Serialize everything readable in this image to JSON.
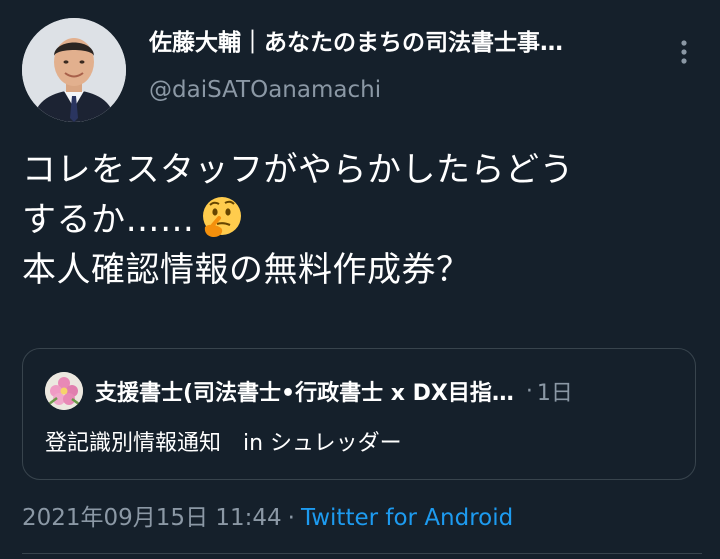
{
  "author": {
    "display_name": "佐藤大輔｜あなたのまちの司法書士事…",
    "handle": "@daiSATOanamachi"
  },
  "icons": {
    "more": "more-options-icon",
    "emoji": "thinking-face-emoji"
  },
  "tweet": {
    "line1": "コレをスタッフがやらかしたらどう",
    "line2": "するか……",
    "line3": "本人確認情報の無料作成券？"
  },
  "quote": {
    "name": "支援書士(司法書士•行政書士 x DX目指…",
    "separator": "·",
    "time": "1日",
    "body": "登記識別情報通知　in シュレッダー"
  },
  "meta": {
    "timestamp": "2021年09月15日 11:44",
    "separator": "·",
    "source": "Twitter for Android"
  },
  "colors": {
    "background": "#15202b",
    "secondary_text": "#8b98a5",
    "link": "#1d9bf0",
    "border": "#38444d"
  }
}
